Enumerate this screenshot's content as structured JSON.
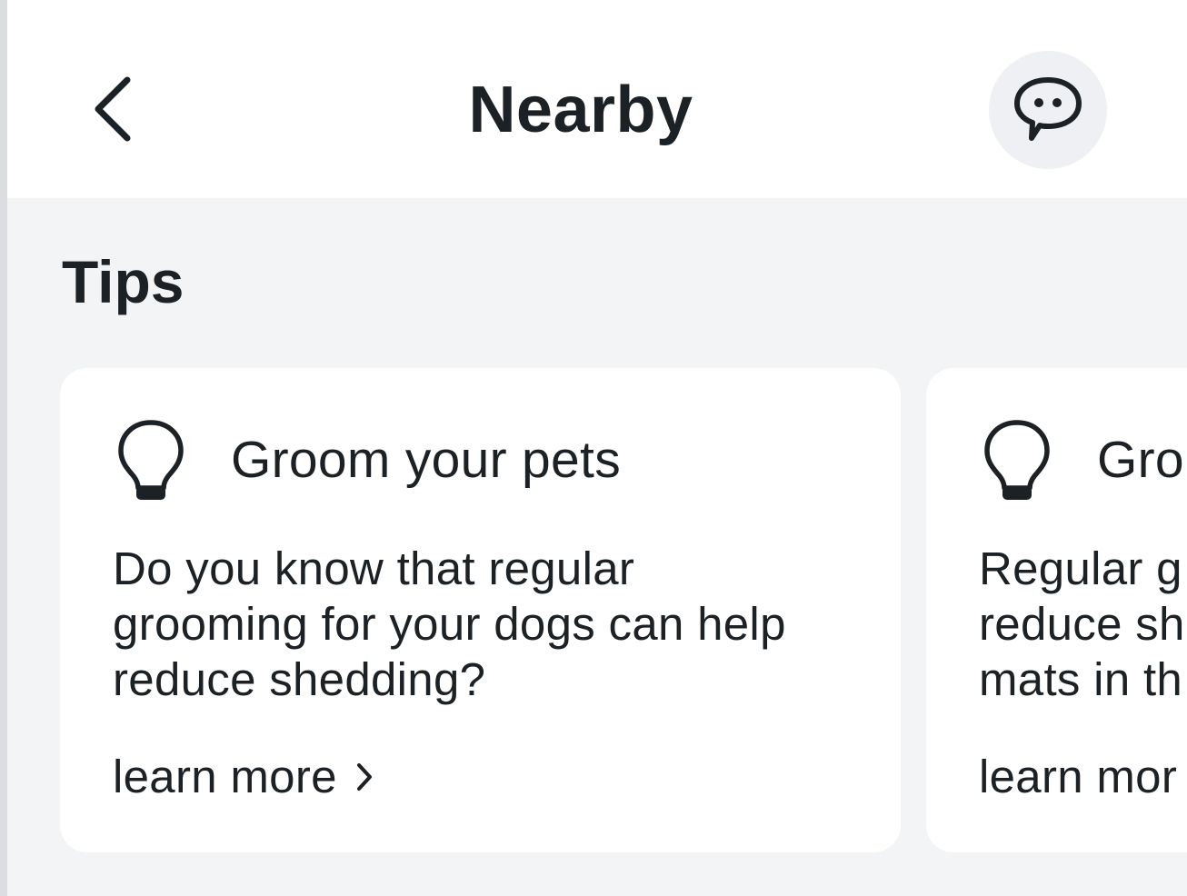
{
  "header": {
    "title": "Nearby",
    "back_icon": "chevron-left-icon",
    "chat_icon": "chat-bubble-icon"
  },
  "tips": {
    "section_title": "Tips",
    "cards": [
      {
        "icon": "lightbulb-icon",
        "title": "Groom your pets",
        "body": "Do you know that regular\ngrooming for your dogs can help\nreduce shedding?",
        "link_label": "learn more"
      },
      {
        "icon": "lightbulb-icon",
        "title": "Gro",
        "body": "Regular g\nreduce sh\nmats in th",
        "link_label": "learn mor"
      }
    ]
  },
  "colors": {
    "background": "#f3f4f6",
    "surface": "#ffffff",
    "text": "#1c2126",
    "chat_button_bg": "#eef0f3"
  }
}
